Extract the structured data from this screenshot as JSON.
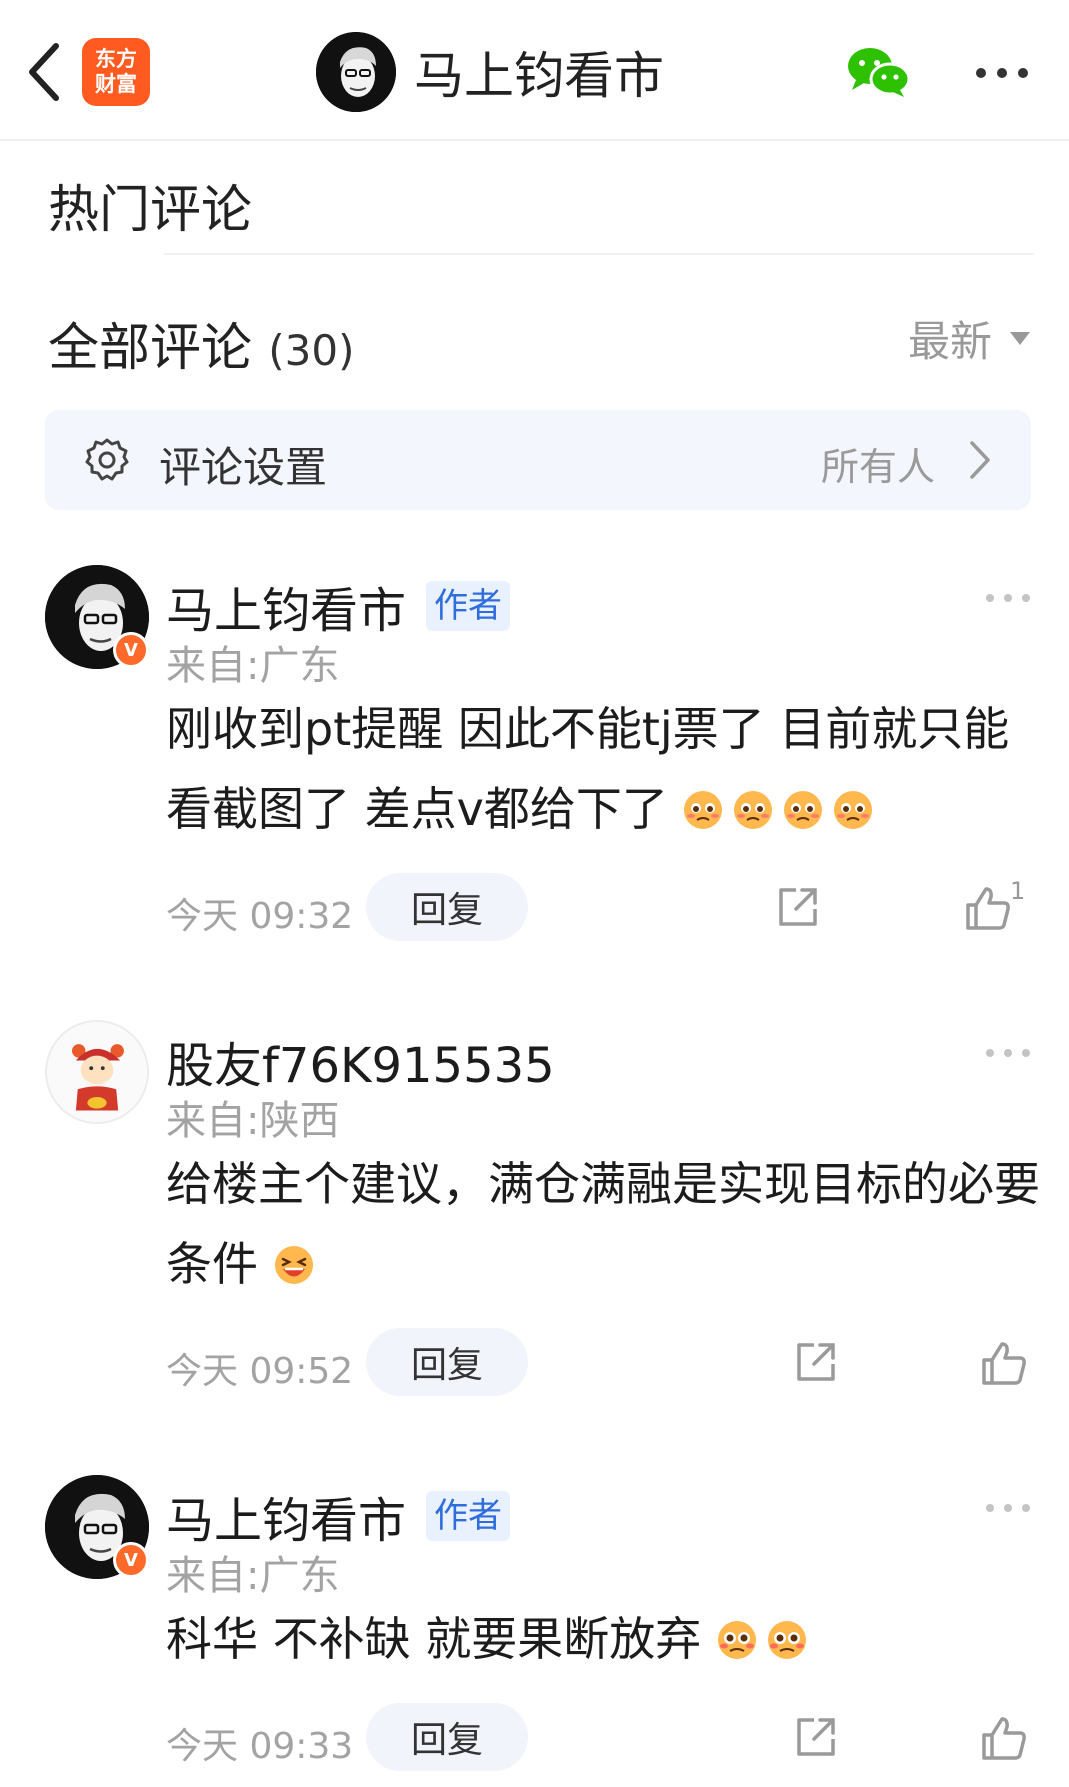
{
  "header": {
    "brand_line1": "东方",
    "brand_line2": "财富",
    "title": "马上钧看市",
    "icons": {
      "back": "chevron-left-icon",
      "wechat": "wechat-icon",
      "more": "more-dots-icon"
    }
  },
  "hot_section": {
    "title": "热门评论"
  },
  "all_section": {
    "title": "全部评论",
    "count": "(30)",
    "sort_label": "最新"
  },
  "comment_setting": {
    "label": "评论设置",
    "value": "所有人"
  },
  "comments": [
    {
      "name": "马上钧看市",
      "tag": "作者",
      "badge": "V",
      "region": "来自:广东",
      "text": "刚收到pt提醒 因此不能tj票了 目前就只能看截图了 差点v都给下了",
      "emojis": [
        "pleading-emoji",
        "pleading-emoji",
        "pleading-emoji",
        "pleading-emoji"
      ],
      "time": "今天 09:32",
      "reply_label": "回复",
      "likes": "1"
    },
    {
      "name": "股友f76K915535",
      "region": "来自:陕西",
      "text": "给楼主个建议，满仓满融是实现目标的必要条件",
      "emojis": [
        "laughing-emoji"
      ],
      "time": "今天 09:52",
      "reply_label": "回复"
    },
    {
      "name": "马上钧看市",
      "tag": "作者",
      "badge": "V",
      "region": "来自:广东",
      "text": "科华  不补缺 就要果断放弃",
      "emojis": [
        "anxious-emoji",
        "anxious-emoji"
      ],
      "time": "今天 09:33",
      "reply_label": "回复"
    }
  ],
  "colors": {
    "brand": "#ff5a1f",
    "wechat": "#2dc100",
    "author_tag_bg": "#e9f1ff",
    "author_tag_text": "#2e6ddb",
    "setting_bg": "#f3f6fc"
  }
}
